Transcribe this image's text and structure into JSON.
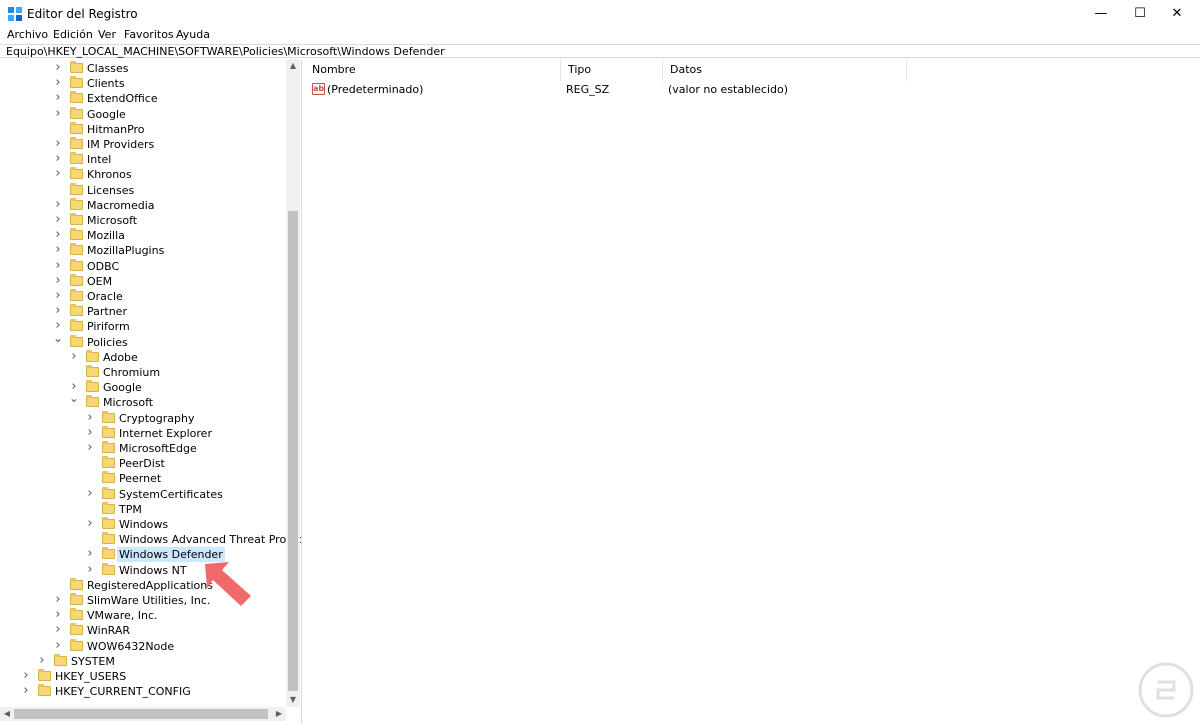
{
  "window": {
    "title": "Editor del Registro",
    "icon": "regedit-icon",
    "controls": {
      "minimize": "—",
      "maximize": "☐",
      "close": "✕"
    }
  },
  "menu": [
    "Archivo",
    "Edición",
    "Ver",
    "Favoritos",
    "Ayuda"
  ],
  "address": "Equipo\\HKEY_LOCAL_MACHINE\\SOFTWARE\\Policies\\Microsoft\\Windows Defender",
  "tree": [
    {
      "label": "Classes",
      "level": 2,
      "expander": "closed"
    },
    {
      "label": "Clients",
      "level": 2,
      "expander": "closed"
    },
    {
      "label": "ExtendOffice",
      "level": 2,
      "expander": "closed"
    },
    {
      "label": "Google",
      "level": 2,
      "expander": "closed"
    },
    {
      "label": "HitmanPro",
      "level": 2,
      "expander": "none"
    },
    {
      "label": "IM Providers",
      "level": 2,
      "expander": "closed"
    },
    {
      "label": "Intel",
      "level": 2,
      "expander": "closed"
    },
    {
      "label": "Khronos",
      "level": 2,
      "expander": "closed"
    },
    {
      "label": "Licenses",
      "level": 2,
      "expander": "none"
    },
    {
      "label": "Macromedia",
      "level": 2,
      "expander": "closed"
    },
    {
      "label": "Microsoft",
      "level": 2,
      "expander": "closed"
    },
    {
      "label": "Mozilla",
      "level": 2,
      "expander": "closed"
    },
    {
      "label": "MozillaPlugins",
      "level": 2,
      "expander": "closed"
    },
    {
      "label": "ODBC",
      "level": 2,
      "expander": "closed"
    },
    {
      "label": "OEM",
      "level": 2,
      "expander": "closed"
    },
    {
      "label": "Oracle",
      "level": 2,
      "expander": "closed"
    },
    {
      "label": "Partner",
      "level": 2,
      "expander": "closed"
    },
    {
      "label": "Piriform",
      "level": 2,
      "expander": "closed"
    },
    {
      "label": "Policies",
      "level": 2,
      "expander": "open"
    },
    {
      "label": "Adobe",
      "level": 3,
      "expander": "closed"
    },
    {
      "label": "Chromium",
      "level": 3,
      "expander": "none"
    },
    {
      "label": "Google",
      "level": 3,
      "expander": "closed"
    },
    {
      "label": "Microsoft",
      "level": 3,
      "expander": "open"
    },
    {
      "label": "Cryptography",
      "level": 4,
      "expander": "closed"
    },
    {
      "label": "Internet Explorer",
      "level": 4,
      "expander": "closed"
    },
    {
      "label": "MicrosoftEdge",
      "level": 4,
      "expander": "closed"
    },
    {
      "label": "PeerDist",
      "level": 4,
      "expander": "none"
    },
    {
      "label": "Peernet",
      "level": 4,
      "expander": "none"
    },
    {
      "label": "SystemCertificates",
      "level": 4,
      "expander": "closed"
    },
    {
      "label": "TPM",
      "level": 4,
      "expander": "none"
    },
    {
      "label": "Windows",
      "level": 4,
      "expander": "closed"
    },
    {
      "label": "Windows Advanced Threat Protection",
      "level": 4,
      "expander": "none"
    },
    {
      "label": "Windows Defender",
      "level": 4,
      "expander": "closed",
      "selected": true
    },
    {
      "label": "Windows NT",
      "level": 4,
      "expander": "closed"
    },
    {
      "label": "RegisteredApplications",
      "level": 2,
      "expander": "none"
    },
    {
      "label": "SlimWare Utilities, Inc.",
      "level": 2,
      "expander": "closed"
    },
    {
      "label": "VMware, Inc.",
      "level": 2,
      "expander": "closed"
    },
    {
      "label": "WinRAR",
      "level": 2,
      "expander": "closed"
    },
    {
      "label": "WOW6432Node",
      "level": 2,
      "expander": "closed"
    },
    {
      "label": "SYSTEM",
      "level": 1,
      "expander": "closed"
    },
    {
      "label": "HKEY_USERS",
      "level": 0,
      "expander": "closed"
    },
    {
      "label": "HKEY_CURRENT_CONFIG",
      "level": 0,
      "expander": "closed"
    }
  ],
  "columns": {
    "name": "Nombre",
    "type": "Tipo",
    "data": "Datos"
  },
  "values": [
    {
      "name": "(Predeterminado)",
      "type": "REG_SZ",
      "data": "(valor no establecido)",
      "icon": "string-value-icon"
    }
  ],
  "colors": {
    "selection": "#cce8ff",
    "folder": "#f7d774",
    "pointer": "#f06a6a"
  }
}
